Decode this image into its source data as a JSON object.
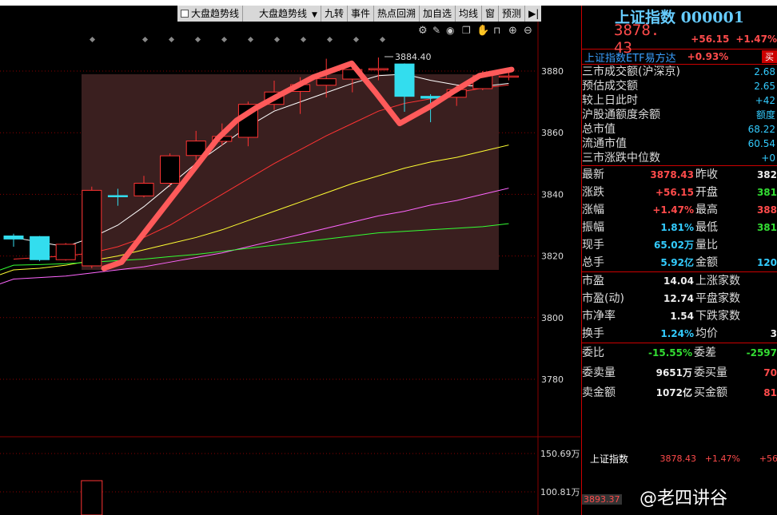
{
  "toolbar": {
    "check_label": "大盘趋势线",
    "select_label": "大盘趋势线",
    "buttons": [
      "九转",
      "事件",
      "热点回溯",
      "加自选",
      "均线",
      "窗",
      "预测"
    ]
  },
  "price_axis": [
    "3880",
    "3860",
    "3840",
    "3820",
    "3800",
    "3780"
  ],
  "volume_axis": [
    "150.69万",
    "100.81万"
  ],
  "peak_label": "3884.40",
  "chart_data": {
    "type": "candlestick",
    "ylim": [
      3768,
      3893
    ],
    "candles": [
      {
        "o": 3825.5,
        "c": 3826.5,
        "h": 3827.2,
        "l": 3823,
        "dir": "down"
      },
      {
        "o": 3826.3,
        "c": 3818.8,
        "h": 3826.5,
        "l": 3818.3,
        "dir": "down"
      },
      {
        "o": 3818.8,
        "c": 3823.8,
        "h": 3824.2,
        "l": 3818.5,
        "dir": "up"
      },
      {
        "o": 3816.8,
        "c": 3841.3,
        "h": 3842.5,
        "l": 3816.0,
        "dir": "up"
      },
      {
        "o": 3839.2,
        "c": 3839.6,
        "h": 3841.8,
        "l": 3836.3,
        "dir": "down"
      },
      {
        "o": 3839.5,
        "c": 3843.6,
        "h": 3846.0,
        "l": 3839.0,
        "dir": "up"
      },
      {
        "o": 3843.6,
        "c": 3852.5,
        "h": 3853.3,
        "l": 3842.4,
        "dir": "up"
      },
      {
        "o": 3852.6,
        "c": 3857.3,
        "h": 3860.6,
        "l": 3851.0,
        "dir": "up"
      },
      {
        "o": 3857.2,
        "c": 3858.8,
        "h": 3863.0,
        "l": 3855.8,
        "dir": "up"
      },
      {
        "o": 3858.5,
        "c": 3869.2,
        "h": 3870.1,
        "l": 3855.6,
        "dir": "up"
      },
      {
        "o": 3869.2,
        "c": 3873.2,
        "h": 3876.9,
        "l": 3867.4,
        "dir": "up"
      },
      {
        "o": 3873.4,
        "c": 3875.6,
        "h": 3878.0,
        "l": 3866.1,
        "dir": "up"
      },
      {
        "o": 3875.4,
        "c": 3877.5,
        "h": 3884.0,
        "l": 3871.4,
        "dir": "up"
      },
      {
        "o": 3877.4,
        "c": 3880.5,
        "h": 3882.8,
        "l": 3873.1,
        "dir": "up"
      },
      {
        "o": 3880.4,
        "c": 3880.8,
        "h": 3884.4,
        "l": 3877.0,
        "dir": "up"
      },
      {
        "o": 3882.3,
        "c": 3871.8,
        "h": 3882.5,
        "l": 3866.8,
        "dir": "down"
      },
      {
        "o": 3871.8,
        "c": 3871.2,
        "h": 3872.5,
        "l": 3863.4,
        "dir": "down"
      },
      {
        "o": 3871.5,
        "c": 3874.0,
        "h": 3875.3,
        "l": 3868.7,
        "dir": "up"
      },
      {
        "o": 3874.3,
        "c": 3878.5,
        "h": 3880.0,
        "l": 3873.8,
        "dir": "up"
      },
      {
        "o": 3878.3,
        "c": 3878.4,
        "h": 3880.9,
        "l": 3877.0,
        "dir": "up"
      }
    ],
    "ma_lines": [
      {
        "color": "#ffffff",
        "values": [
          3826.0,
          3824.5,
          3823.0,
          3826.0,
          3830.0,
          3836.0,
          3843.0,
          3850.0,
          3856.0,
          3862.0,
          3867.0,
          3870.0,
          3873.0,
          3876.0,
          3878.5,
          3879.0,
          3877.0,
          3875.5,
          3875.0,
          3876.0
        ]
      },
      {
        "color": "#ff3333",
        "values": [
          3819.0,
          3819.5,
          3820.0,
          3821.0,
          3823.0,
          3826.0,
          3830.0,
          3835.0,
          3840.0,
          3845.0,
          3850.0,
          3854.5,
          3859.0,
          3863.0,
          3867.0,
          3869.5,
          3871.0,
          3873.0,
          3874.5,
          3875.5
        ]
      },
      {
        "color": "#ffff33",
        "values": [
          3815.5,
          3816.0,
          3817.0,
          3818.5,
          3820.0,
          3822.0,
          3824.0,
          3826.0,
          3828.5,
          3831.5,
          3834.5,
          3837.5,
          3840.5,
          3843.5,
          3846.0,
          3848.5,
          3850.5,
          3852.0,
          3854.0,
          3856.0
        ]
      },
      {
        "color": "#ff66ff",
        "values": [
          3812.5,
          3813.0,
          3813.5,
          3814.5,
          3815.5,
          3816.5,
          3818.0,
          3819.5,
          3821.0,
          3823.0,
          3825.0,
          3827.0,
          3829.0,
          3831.0,
          3833.0,
          3834.5,
          3836.5,
          3838.0,
          3840.0,
          3842.0
        ]
      },
      {
        "color": "#33ff33",
        "values": [
          3817.0,
          3817.2,
          3817.5,
          3818.0,
          3818.5,
          3819.0,
          3819.8,
          3820.5,
          3821.5,
          3822.5,
          3823.5,
          3824.5,
          3825.5,
          3826.5,
          3827.5,
          3828.0,
          3828.5,
          3829.0,
          3829.5,
          3830.5
        ]
      }
    ],
    "trend_line": [
      3816.0,
      3818.0,
      3826.0,
      3834.0,
      3842.0,
      3850.0,
      3858.0,
      3864.0,
      3868.0,
      3872.0,
      3878.0,
      3882.5,
      3873.0,
      3863.0,
      3868.5,
      3873.5,
      3878.5,
      3880.5
    ],
    "volume_bars": [
      {
        "index": 3,
        "value": 110.0
      }
    ],
    "volume_range": [
      0,
      160
    ]
  },
  "panel": {
    "title": "上证指数 000001",
    "price": "3878. 43",
    "change": "+56.15",
    "pct": "+1.47%",
    "etf_name": "上证指数ETF易方达",
    "etf_pct": "+0.93%",
    "buy_label": "买",
    "info_rows": [
      {
        "label": "三市成交额(沪深京)",
        "value": "2.68"
      },
      {
        "label": "预估成交额",
        "value": "2.65"
      },
      {
        "label": "较上日此时",
        "value": "+42"
      },
      {
        "label": "沪股通额度余额",
        "value": "额度"
      },
      {
        "label": "总市值",
        "value": "68.22"
      },
      {
        "label": "流通市值",
        "value": "60.54"
      },
      {
        "label": "三市涨跌中位数",
        "value": "+0"
      }
    ],
    "quote_rows": [
      {
        "l1": "最新",
        "v1": "3878.43",
        "c1": "red",
        "l2": "昨收",
        "v2": "382",
        "c2": "wht"
      },
      {
        "l1": "涨跌",
        "v1": "+56.15",
        "c1": "red",
        "l2": "开盘",
        "v2": "381",
        "c2": "grn"
      },
      {
        "l1": "涨幅",
        "v1": "+1.47%",
        "c1": "red",
        "l2": "最高",
        "v2": "388",
        "c2": "red"
      },
      {
        "l1": "振幅",
        "v1": "1.81%",
        "c1": "cyn",
        "l2": "最低",
        "v2": "381",
        "c2": "grn"
      },
      {
        "l1": "现手",
        "v1": "65.02万",
        "c1": "cyn",
        "l2": "量比",
        "v2": "",
        "c2": "wht"
      },
      {
        "l1": "总手",
        "v1": "5.92亿",
        "c1": "cyn",
        "l2": "金额",
        "v2": "120",
        "c2": "cyn"
      }
    ],
    "stat_rows": [
      {
        "l1": "市盈",
        "v1": "14.04",
        "c1": "wht",
        "l2": "上涨家数",
        "v2": "",
        "c2": "red"
      },
      {
        "l1": "市盈(动)",
        "v1": "12.74",
        "c1": "wht",
        "l2": "平盘家数",
        "v2": "",
        "c2": "wht"
      },
      {
        "l1": "市净率",
        "v1": "1.54",
        "c1": "wht",
        "l2": "下跌家数",
        "v2": "",
        "c2": "grn"
      },
      {
        "l1": "换手",
        "v1": "1.24%",
        "c1": "cyn",
        "l2": "均价",
        "v2": "3",
        "c2": "wht"
      }
    ],
    "order_rows": [
      {
        "l1": "委比",
        "v1": "-15.55%",
        "c1": "grn",
        "l2": "委差",
        "v2": "-2597",
        "c2": "grn"
      },
      {
        "l1": "委卖量",
        "v1": "9651万",
        "c1": "wht",
        "l2": "委买量",
        "v2": "70",
        "c2": "red"
      },
      {
        "l1": "卖金额",
        "v1": "1072亿",
        "c1": "wht",
        "l2": "买金额",
        "v2": "81",
        "c2": "red"
      }
    ],
    "mini": {
      "name": "上证指数",
      "price": "3878.43",
      "pct": "+1.47%",
      "extra": "+56"
    },
    "mini_scale": "3893.37"
  },
  "watermark": "@老四讲谷"
}
